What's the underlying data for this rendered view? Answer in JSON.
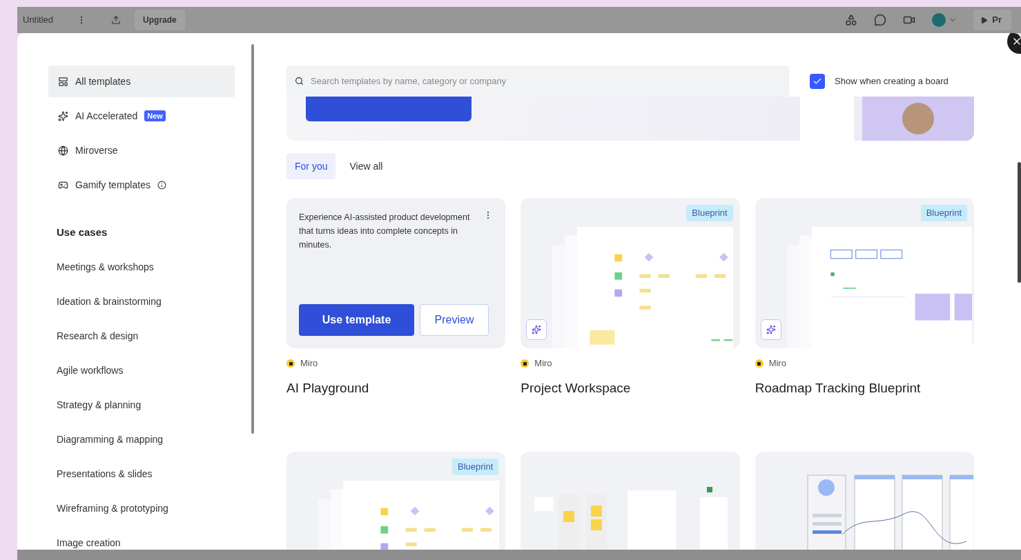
{
  "app_bar": {
    "title": "Untitled",
    "upgrade": "Upgrade",
    "present": "Pr"
  },
  "sidebar": {
    "items": [
      {
        "label": "All templates",
        "selected": true
      },
      {
        "label": "AI Accelerated",
        "badge": "New",
        "selected": false
      },
      {
        "label": "Miroverse",
        "selected": false
      },
      {
        "label": "Gamify templates",
        "info": true,
        "selected": false
      }
    ],
    "section_title": "Use cases",
    "use_cases": [
      "Meetings & workshops",
      "Ideation & brainstorming",
      "Research & design",
      "Agile workflows",
      "Strategy & planning",
      "Diagramming & mapping",
      "Presentations & slides",
      "Wireframing & prototyping",
      "Image creation"
    ]
  },
  "search": {
    "placeholder": "Search templates by name, category or company"
  },
  "show_when_creating": {
    "label": "Show when creating a board",
    "checked": true
  },
  "tabs": [
    {
      "label": "For you",
      "selected": true
    },
    {
      "label": "View all",
      "selected": false
    }
  ],
  "cards": [
    {
      "kind": "promo",
      "description": "Experience AI-assisted product development that turns ideas into complete concepts in minutes.",
      "primary": "Use template",
      "secondary": "Preview",
      "creator": "Miro",
      "title": "AI Playground"
    },
    {
      "kind": "flow",
      "badge": "Blueprint",
      "ai": true,
      "creator": "Miro",
      "title": "Project Workspace"
    },
    {
      "kind": "roadmap",
      "badge": "Blueprint",
      "ai": true,
      "creator": "Miro",
      "title": "Roadmap Tracking Blueprint"
    }
  ],
  "more_cards": [
    {
      "kind": "flow",
      "badge": "Blueprint"
    },
    {
      "kind": "stickies"
    },
    {
      "kind": "wireframe"
    }
  ]
}
